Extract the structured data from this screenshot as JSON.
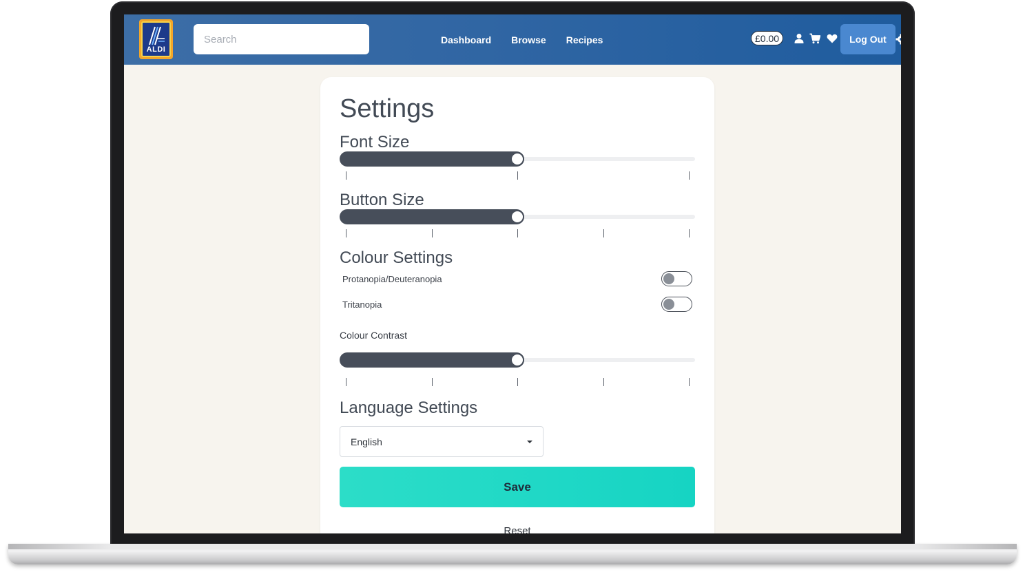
{
  "header": {
    "logo_text": "ALDI",
    "search_placeholder": "Search",
    "nav": [
      "Dashboard",
      "Browse",
      "Recipes"
    ],
    "cart_total": "£0.00",
    "logout_label": "Log Out",
    "icons": [
      "user-icon",
      "cart-icon",
      "heart-icon",
      "gear-icon"
    ]
  },
  "settings": {
    "title": "Settings",
    "font_size": {
      "label": "Font Size",
      "value_fraction": 0.5,
      "tick_count": 3
    },
    "button_size": {
      "label": "Button Size",
      "value_fraction": 0.5,
      "tick_count": 5
    },
    "colour": {
      "label": "Colour Settings",
      "toggles": [
        {
          "label": "Protanopia/Deuteranopia",
          "on": false
        },
        {
          "label": "Tritanopia",
          "on": false
        }
      ]
    },
    "contrast": {
      "label": "Colour Contrast",
      "value_fraction": 0.5,
      "tick_count": 5
    },
    "language": {
      "label": "Language Settings",
      "selected": "English"
    },
    "save_label": "Save",
    "reset_label": "Reset"
  },
  "colors": {
    "nav_start": "#3d6ea6",
    "nav_end": "#1f5c9e",
    "slider_fill": "#474e5a",
    "save_button": "#1fd8c6",
    "page_bg": "#f7f4ee"
  }
}
